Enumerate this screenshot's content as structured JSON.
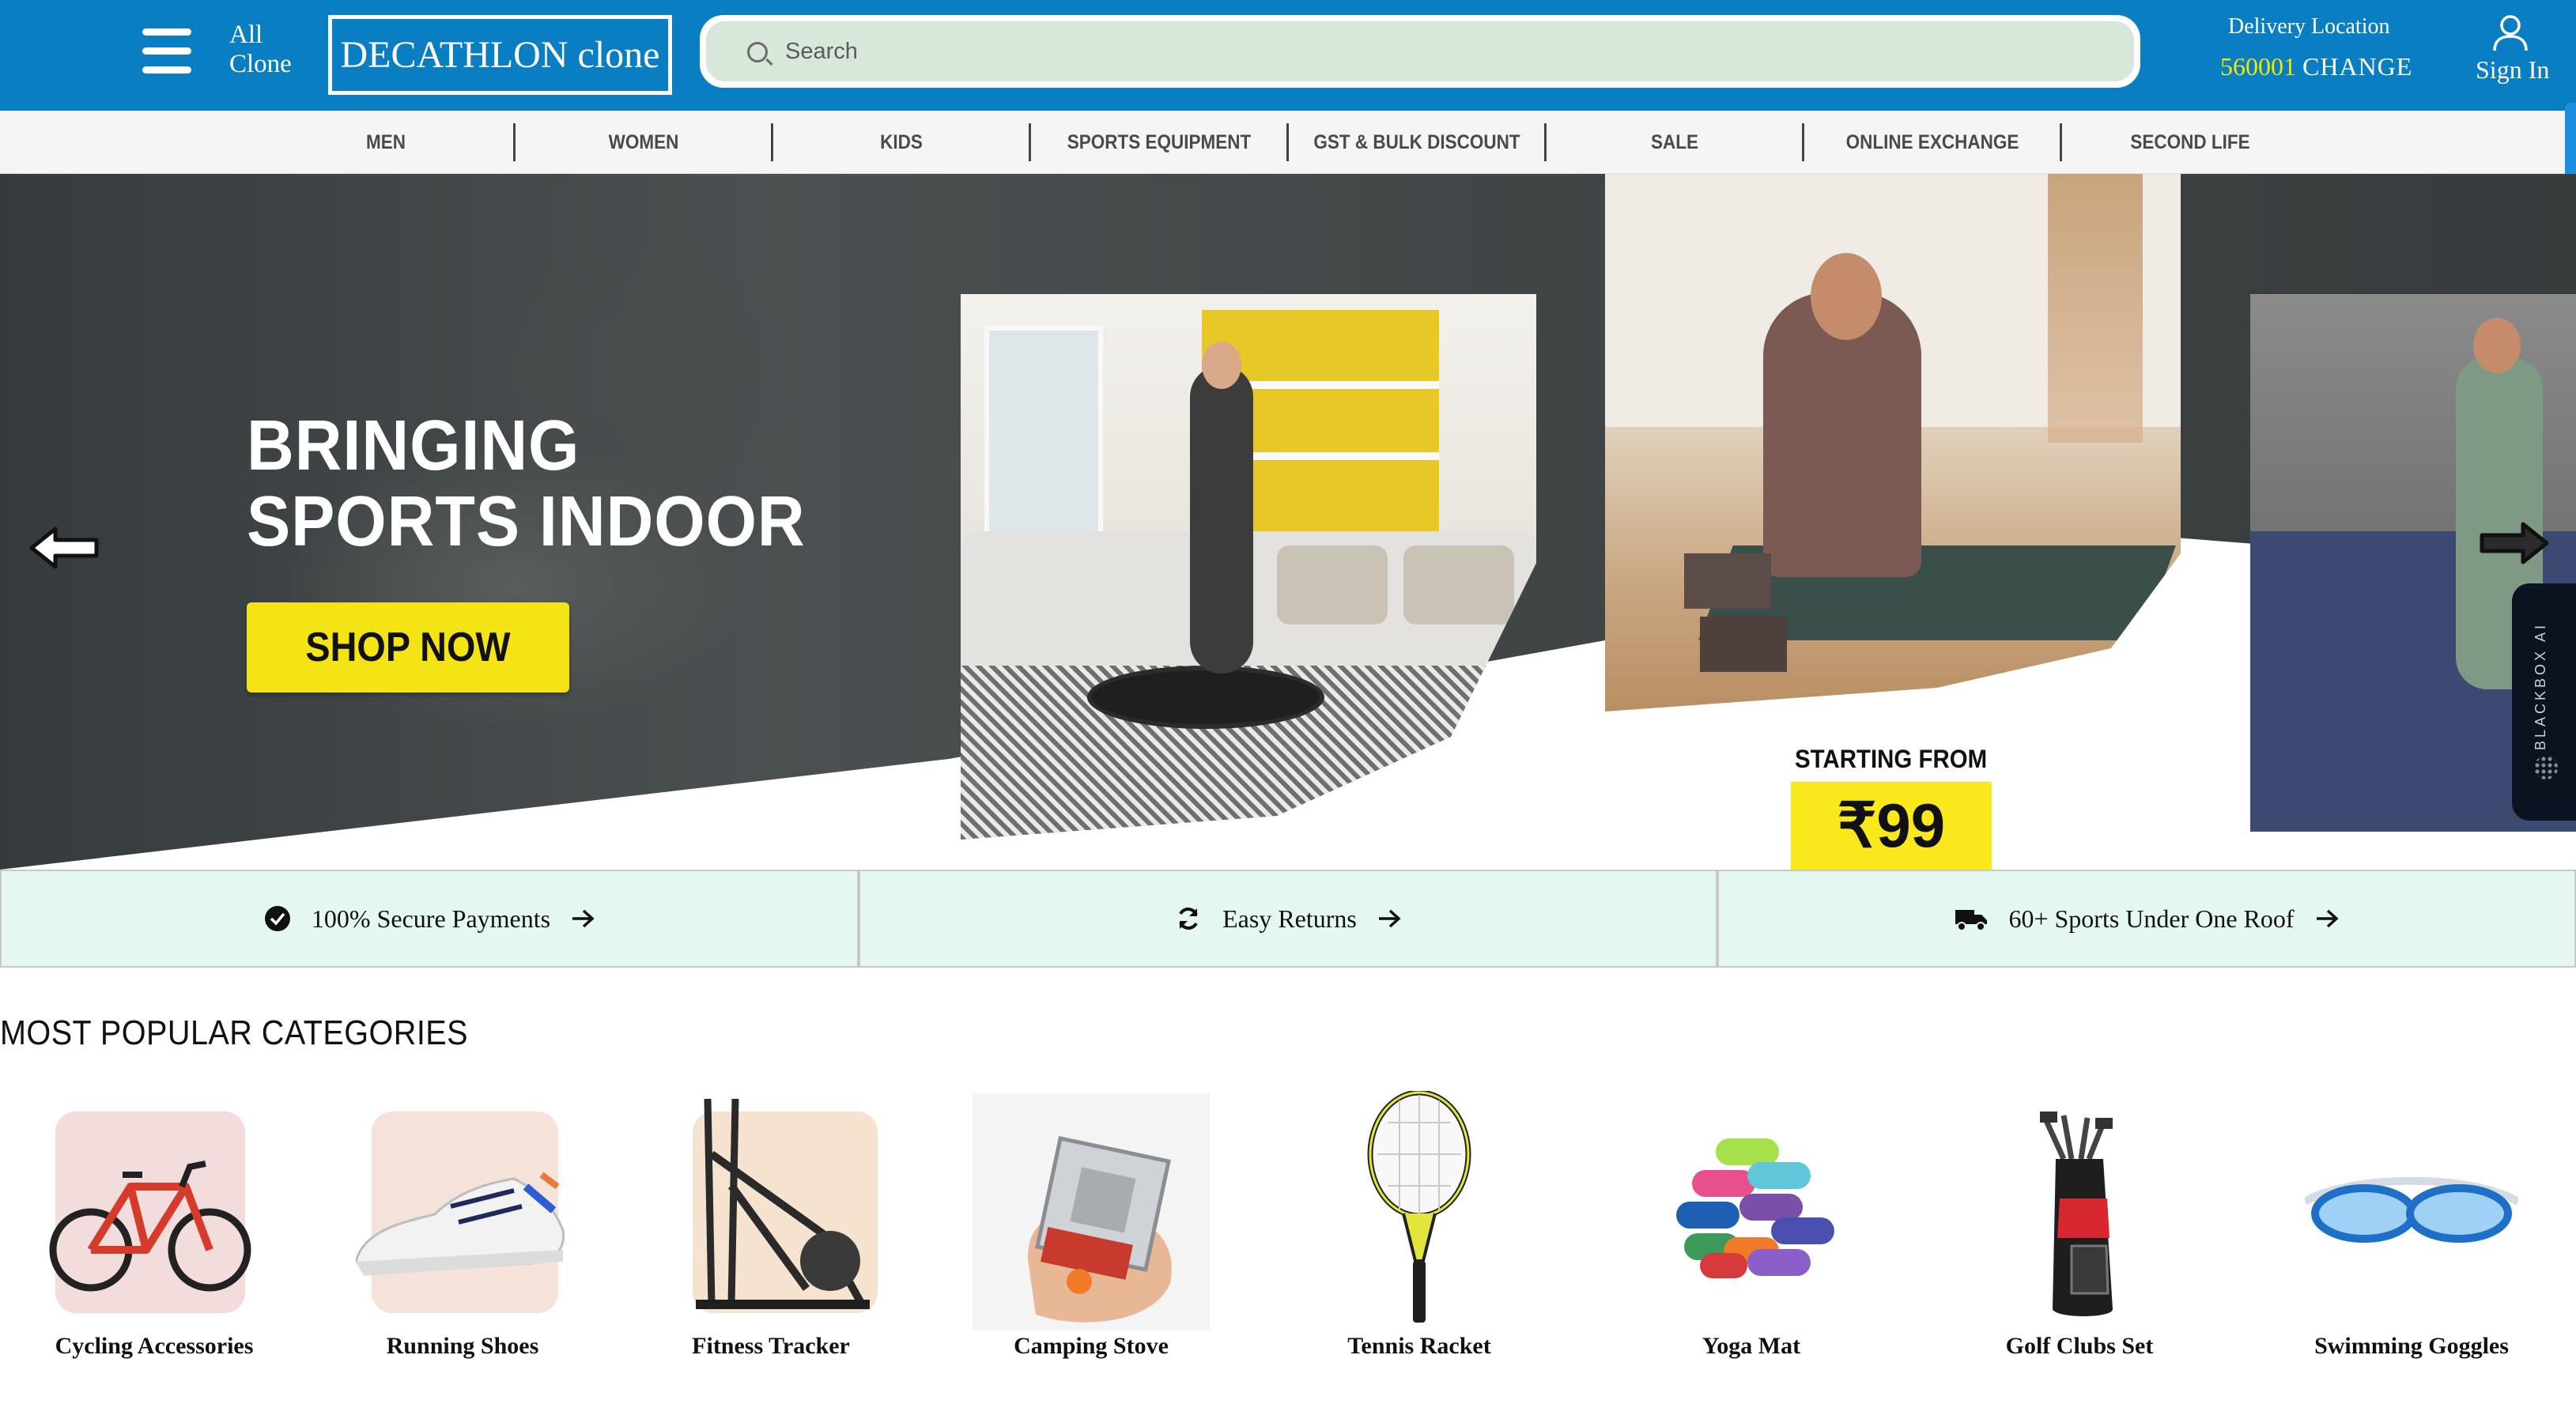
{
  "header": {
    "all_label_line1": "All",
    "all_label_line2": "Clone",
    "logo_text": "DECATHLON clone",
    "search_placeholder": "Search",
    "delivery_label": "Delivery Location",
    "pincode": "560001",
    "change_label": "CHANGE",
    "signin_label": "Sign In"
  },
  "nav": {
    "items": [
      "MEN",
      "WOMEN",
      "KIDS",
      "SPORTS EQUIPMENT",
      "GST & BULK DISCOUNT",
      "SALE",
      "ONLINE EXCHANGE",
      "SECOND LIFE"
    ]
  },
  "hero": {
    "title_line1": "BRINGING",
    "title_line2": "SPORTS INDOOR",
    "cta_label": "SHOP NOW",
    "starting_from": "STARTING FROM",
    "price": "₹99"
  },
  "sidebar_widget": {
    "label": "BLACKBOX AI"
  },
  "features": [
    {
      "label": "100% Secure Payments",
      "icon": "check-circle-icon"
    },
    {
      "label": "Easy Returns",
      "icon": "refresh-icon"
    },
    {
      "label": "60+ Sports Under One Roof",
      "icon": "truck-icon"
    }
  ],
  "categories_section": {
    "title": "MOST POPULAR CATEGORIES",
    "items": [
      {
        "label": "Cycling Accessories",
        "icon": "bicycle-image"
      },
      {
        "label": "Running Shoes",
        "icon": "shoe-image"
      },
      {
        "label": "Fitness Tracker",
        "icon": "elliptical-trainer-image"
      },
      {
        "label": "Camping Stove",
        "icon": "camping-stove-image"
      },
      {
        "label": "Tennis Racket",
        "icon": "tennis-racket-image"
      },
      {
        "label": "Yoga Mat",
        "icon": "yoga-mats-image"
      },
      {
        "label": "Golf Clubs Set",
        "icon": "golf-bag-image"
      },
      {
        "label": "Swimming Goggles",
        "icon": "goggles-image"
      }
    ]
  },
  "colors": {
    "header_blue": "#0a7ec3",
    "cta_yellow": "#f5e415",
    "pincode_yellow": "#f5e600",
    "feature_bg": "#e4f8f1"
  }
}
